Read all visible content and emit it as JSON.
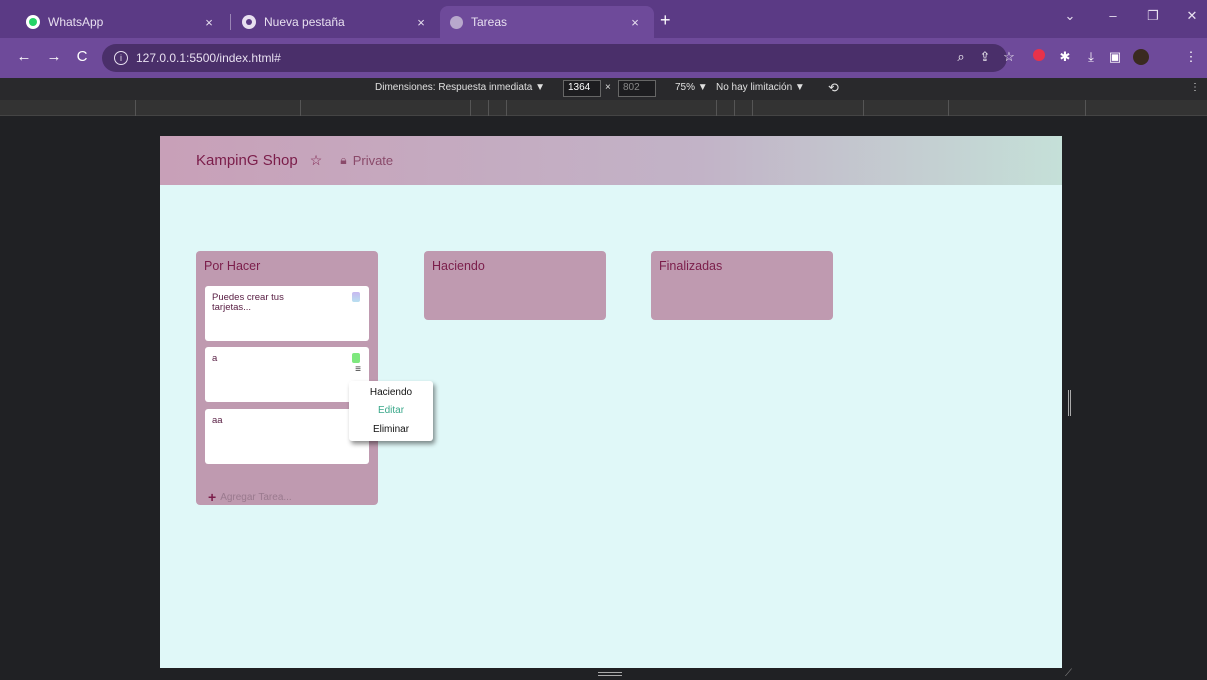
{
  "browser": {
    "tabs": [
      {
        "title": "WhatsApp",
        "icon": "whatsapp-icon",
        "close": "×"
      },
      {
        "title": "Nueva pestaña",
        "icon": "chrome-icon",
        "close": "×"
      },
      {
        "title": "Tareas",
        "icon": "globe-icon",
        "close": "×"
      }
    ],
    "new_tab": "+",
    "url": "127.0.0.1:5500/index.html#",
    "window_controls": {
      "chevron": "⌄",
      "minimize": "–",
      "restore": "❐",
      "close": "✕"
    }
  },
  "devtools": {
    "dimensions_label": "Dimensiones: Respuesta inmediata ▼",
    "width": "1364",
    "times": "×",
    "height": "802",
    "zoom": "75% ▼",
    "throttle": "No hay limitación ▼"
  },
  "app": {
    "brand": "KampinG Shop",
    "visibility": "Private",
    "columns": [
      {
        "title": "Por Hacer",
        "cards": [
          {
            "text": "Puedes crear tus tarjetas...",
            "tag_color": "#c8b8f0"
          },
          {
            "text": "a",
            "tag_color": "#7ee87e"
          },
          {
            "text": "aa",
            "tag_color": ""
          }
        ],
        "add_label": "Agregar Tarea..."
      },
      {
        "title": "Haciendo",
        "cards": []
      },
      {
        "title": "Finalizadas",
        "cards": []
      }
    ],
    "context_menu": {
      "items": [
        "Haciendo",
        "Editar",
        "Eliminar"
      ]
    }
  },
  "colors": {
    "accent": "#7b1d4a",
    "board_bg": "#e0f8f8",
    "column_bg": "#bf9ab0",
    "edit_color": "#3aa88a"
  }
}
